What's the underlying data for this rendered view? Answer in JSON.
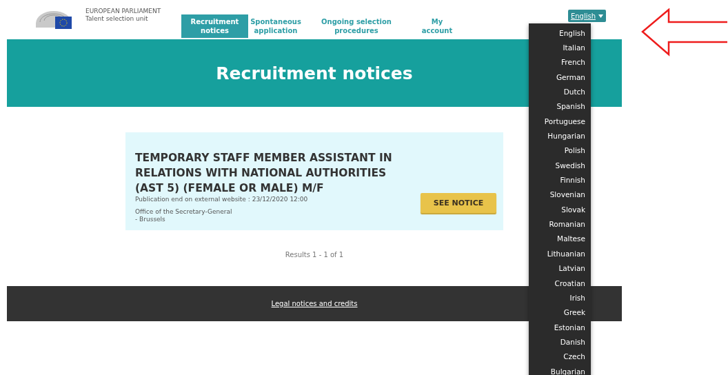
{
  "header": {
    "org_name": "EUROPEAN PARLIAMENT",
    "org_unit": "Talent selection unit"
  },
  "nav": [
    {
      "label": "Recruitment notices",
      "selected": true
    },
    {
      "label": "Spontaneous application",
      "selected": false
    },
    {
      "label": "Ongoing selection procedures",
      "selected": false
    },
    {
      "label": "My account",
      "selected": false
    }
  ],
  "language": {
    "current": "English",
    "expanded": true,
    "options": [
      "English",
      "Italian",
      "French",
      "German",
      "Dutch",
      "Spanish",
      "Portuguese",
      "Hungarian",
      "Polish",
      "Swedish",
      "Finnish",
      "Slovenian",
      "Slovak",
      "Romanian",
      "Maltese",
      "Lithuanian",
      "Latvian",
      "Croatian",
      "Irish",
      "Greek",
      "Estonian",
      "Danish",
      "Czech",
      "Bulgarian"
    ]
  },
  "banner": {
    "title": "Recruitment notices"
  },
  "notices": [
    {
      "title": "TEMPORARY STAFF MEMBER ASSISTANT IN RELATIONS WITH NATIONAL AUTHORITIES (AST 5) (FEMALE OR MALE) M/F",
      "publication": "Publication end on external website : 23/12/2020 12:00",
      "department": "Office of the Secretary-General",
      "location": "- Brussels",
      "button": "SEE NOTICE"
    }
  ],
  "results": "Results 1 - 1 of 1",
  "footer": {
    "link": "Legal notices and credits"
  },
  "annotation": {
    "kind": "arrow"
  }
}
